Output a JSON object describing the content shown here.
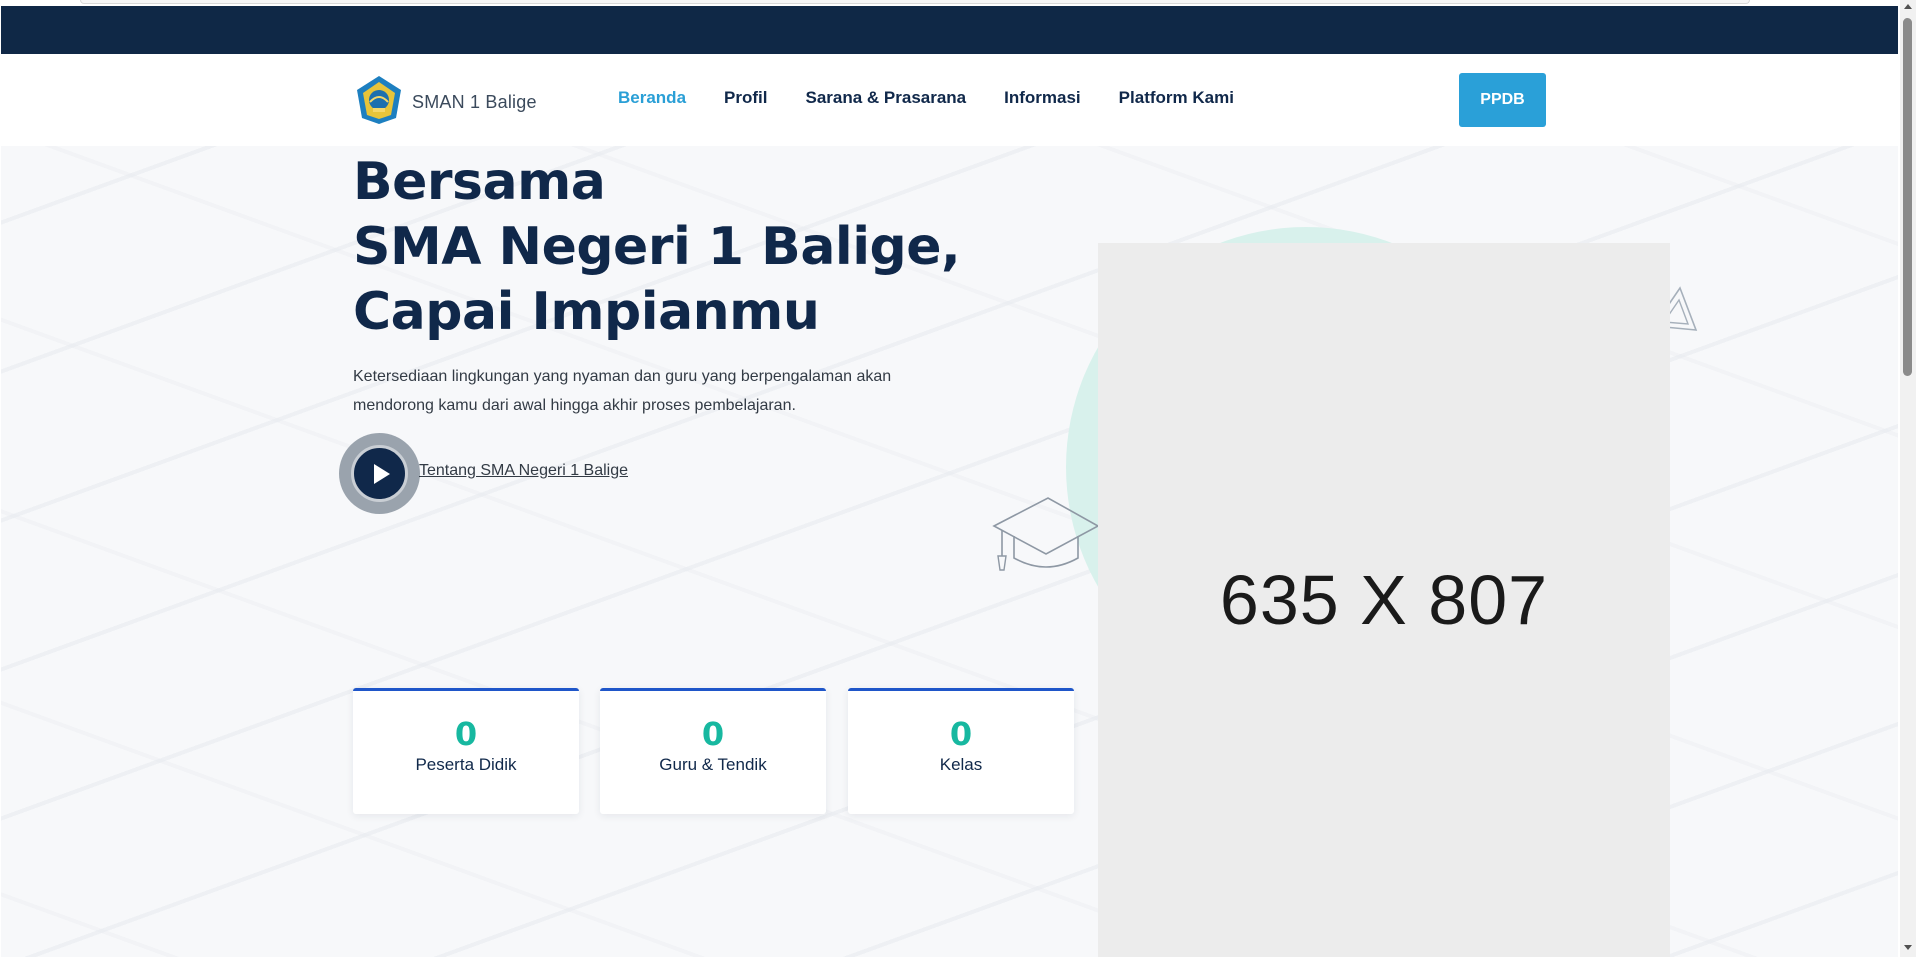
{
  "header": {
    "logo_text": "SMAN 1 Balige",
    "nav": [
      {
        "label": "Beranda",
        "active": true
      },
      {
        "label": "Profil",
        "active": false
      },
      {
        "label": "Sarana & Prasarana",
        "active": false
      },
      {
        "label": "Informasi",
        "active": false
      },
      {
        "label": "Platform Kami",
        "active": false
      }
    ],
    "cta_label": "PPDB"
  },
  "hero": {
    "title_lines": [
      "Bersama",
      "SMA Negeri 1 Balige,",
      "Capai Impianmu"
    ],
    "description": "Ketersediaan lingkungan yang nyaman dan guru yang berpengalaman akan mendorong kamu dari awal hingga akhir proses pembelajaran.",
    "video_link": "Tentang SMA Negeri 1 Balige",
    "image_placeholder": "635 X 807"
  },
  "stats": [
    {
      "value": "0",
      "label": "Peserta Didik"
    },
    {
      "value": "0",
      "label": "Guru & Tendik"
    },
    {
      "value": "0",
      "label": "Kelas"
    }
  ],
  "colors": {
    "navy": "#0f2846",
    "accent_blue": "#2aa0d8",
    "teal_number": "#17b8a0",
    "card_border": "#1f56c9",
    "mint_circle": "#d8f1ec"
  },
  "icons": [
    "school-logo-icon",
    "play-icon",
    "graduation-cap-icon",
    "triangle-ruler-icon"
  ]
}
